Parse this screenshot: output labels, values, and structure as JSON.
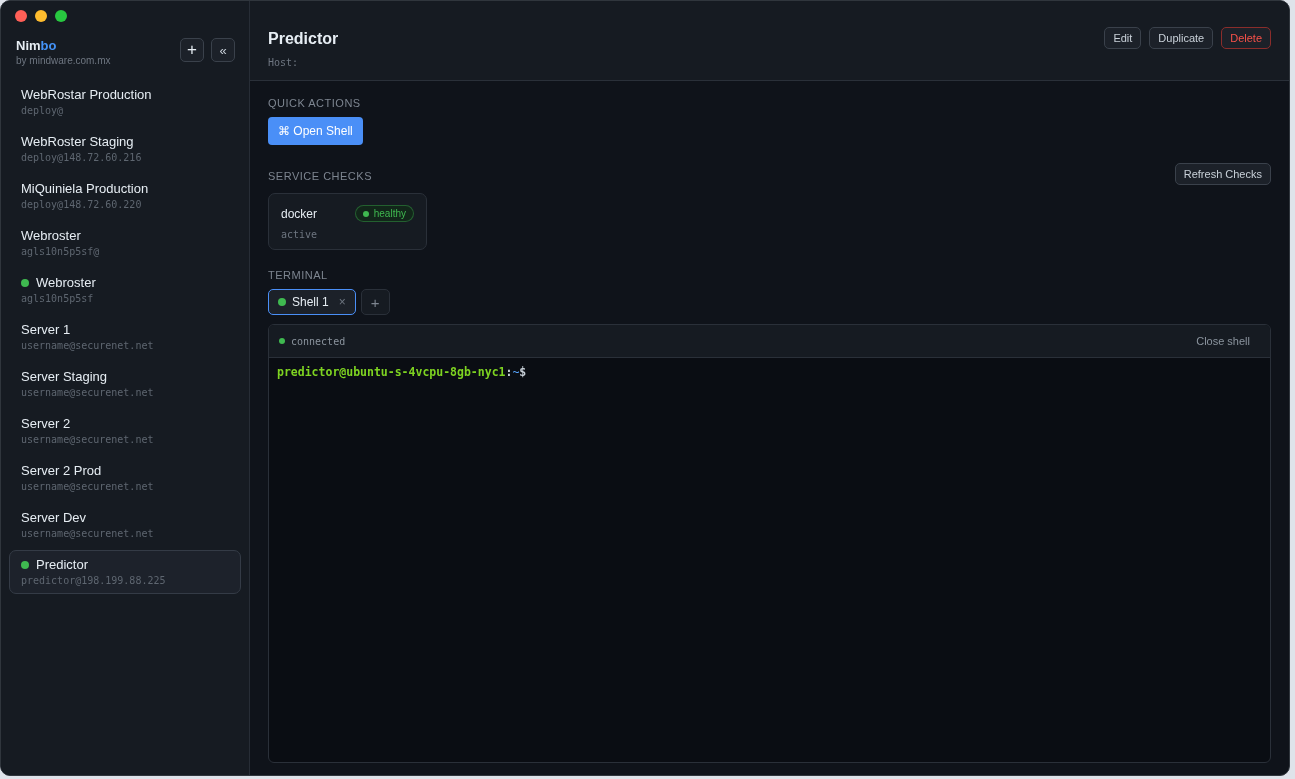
{
  "app": {
    "name_part1": "Nim",
    "name_part2": "bo",
    "byline": "by mindware.com.mx",
    "add_label": "+",
    "collapse_label": "«"
  },
  "servers": [
    {
      "name": "WebRostar Production",
      "host": "deploy@",
      "connected": false,
      "selected": false
    },
    {
      "name": "WebRoster Staging",
      "host": "deploy@148.72.60.216",
      "connected": false,
      "selected": false
    },
    {
      "name": "MiQuiniela Production",
      "host": "deploy@148.72.60.220",
      "connected": false,
      "selected": false
    },
    {
      "name": "Webroster",
      "host": "agls10n5p5sf@",
      "connected": false,
      "selected": false
    },
    {
      "name": "Webroster",
      "host": "agls10n5p5sf",
      "connected": true,
      "selected": false
    },
    {
      "name": "Server 1",
      "host": "username@securenet.net",
      "connected": false,
      "selected": false
    },
    {
      "name": "Server Staging",
      "host": "username@securenet.net",
      "connected": false,
      "selected": false
    },
    {
      "name": "Server 2",
      "host": "username@securenet.net",
      "connected": false,
      "selected": false
    },
    {
      "name": "Server 2 Prod",
      "host": "username@securenet.net",
      "connected": false,
      "selected": false
    },
    {
      "name": "Server Dev",
      "host": "username@securenet.net",
      "connected": false,
      "selected": false
    },
    {
      "name": "Predictor",
      "host": "predictor@198.199.88.225",
      "connected": true,
      "selected": true
    }
  ],
  "header": {
    "title": "Predictor",
    "host": "Host:",
    "buttons": [
      {
        "label": "Edit",
        "kind": "normal"
      },
      {
        "label": "Duplicate",
        "kind": "normal"
      },
      {
        "label": "Delete",
        "kind": "danger"
      }
    ]
  },
  "quick_actions": {
    "heading": "QUICK ACTIONS",
    "button": "⌘ Open Shell"
  },
  "service_checks": {
    "heading": "SERVICE CHECKS",
    "refresh": "Refresh Checks",
    "checks": [
      {
        "name": "docker",
        "status": "healthy",
        "detail": "active",
        "color": "#3fb950"
      }
    ]
  },
  "terminal": {
    "heading": "TERMINAL",
    "tabs": [
      {
        "label": "Shell 1",
        "close": "×",
        "selected": true,
        "connected": true
      }
    ],
    "new_tab": "+",
    "status": "connected",
    "connected": true,
    "close_label": "Close shell",
    "prompt_user": "predictor@ubuntu-s-4vcpu-8gb-nyc1",
    "prompt_sep": ":",
    "prompt_path": "~",
    "prompt_sign": "$"
  }
}
